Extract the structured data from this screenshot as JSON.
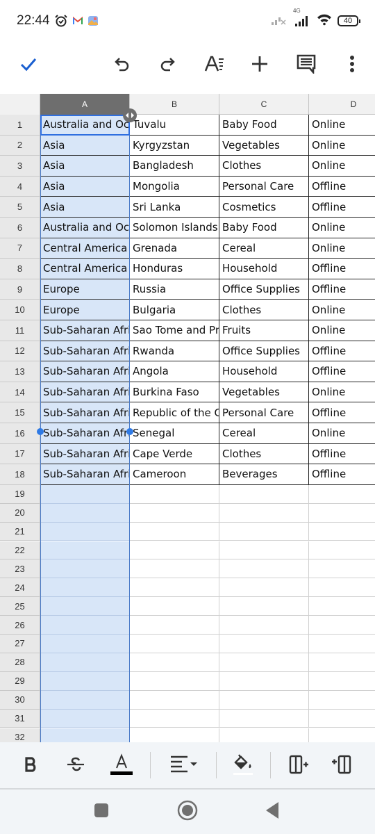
{
  "status_bar": {
    "time": "22:44",
    "battery": "40",
    "network_label": "4G",
    "icons": [
      "alarm-icon",
      "gmail-icon",
      "photos-icon",
      "signal-off-icon",
      "signal-4g-icon",
      "wifi-icon",
      "battery-icon"
    ]
  },
  "toolbar": {
    "buttons": [
      "check-icon",
      "undo-icon",
      "redo-icon",
      "text-format-icon",
      "insert-icon",
      "comment-icon",
      "more-icon"
    ]
  },
  "colors": {
    "accent": "#1a5fd0",
    "selection_fill": "#d8e6f8",
    "selected_header": "#6e6e6e"
  },
  "sheet": {
    "columns": [
      "A",
      "B",
      "C",
      "D"
    ],
    "selected_column": "A",
    "active_cell": "A1",
    "row_numbers": [
      "1",
      "2",
      "3",
      "4",
      "5",
      "6",
      "7",
      "8",
      "9",
      "10",
      "11",
      "12",
      "13",
      "14",
      "15",
      "16",
      "17",
      "18",
      "19",
      "20",
      "21",
      "22",
      "23",
      "24",
      "25",
      "26",
      "27",
      "28",
      "29",
      "30",
      "31",
      "32"
    ],
    "rows": [
      [
        "Australia and Oce",
        "Tuvalu",
        "Baby Food",
        "Online"
      ],
      [
        "Asia",
        "Kyrgyzstan",
        "Vegetables",
        "Online"
      ],
      [
        "Asia",
        "Bangladesh",
        "Clothes",
        "Online"
      ],
      [
        "Asia",
        "Mongolia",
        "Personal Care",
        "Offline"
      ],
      [
        "Asia",
        "Sri Lanka",
        "Cosmetics",
        "Offline"
      ],
      [
        "Australia and Oce",
        "Solomon Islands",
        "Baby Food",
        "Online"
      ],
      [
        "Central America a",
        "Grenada",
        "Cereal",
        "Online"
      ],
      [
        "Central America a",
        "Honduras",
        "Household",
        "Offline"
      ],
      [
        "Europe",
        "Russia",
        "Office Supplies",
        "Offline"
      ],
      [
        "Europe",
        "Bulgaria",
        "Clothes",
        "Online"
      ],
      [
        "Sub-Saharan Afric",
        "Sao Tome and Pri",
        "Fruits",
        "Online"
      ],
      [
        "Sub-Saharan Afric",
        "Rwanda",
        "Office Supplies",
        "Offline"
      ],
      [
        "Sub-Saharan Afric",
        "Angola",
        "Household",
        "Offline"
      ],
      [
        "Sub-Saharan Afric",
        "Burkina Faso",
        "Vegetables",
        "Online"
      ],
      [
        "Sub-Saharan Afric",
        "Republic of the Co",
        "Personal Care",
        "Offline"
      ],
      [
        "Sub-Saharan Afric",
        "Senegal",
        "Cereal",
        "Online"
      ],
      [
        "Sub-Saharan Afric",
        "Cape Verde",
        "Clothes",
        "Offline"
      ],
      [
        "Sub-Saharan Afric",
        "Cameroon",
        "Beverages",
        "Offline"
      ]
    ]
  },
  "format_bar": {
    "buttons": [
      "bold-icon",
      "strikethrough-icon",
      "text-color-icon",
      "align-icon",
      "fill-color-icon",
      "insert-column-right-icon",
      "insert-column-left-icon"
    ]
  },
  "nav_bar": {
    "buttons": [
      "recents-icon",
      "home-icon",
      "back-icon"
    ]
  }
}
